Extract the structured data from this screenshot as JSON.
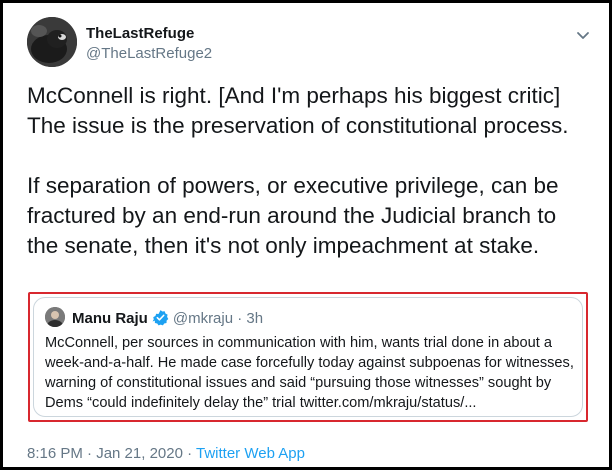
{
  "author": {
    "display_name": "TheLastRefuge",
    "handle": "@TheLastRefuge2"
  },
  "tweet": {
    "paragraphs": [
      "McConnell is right. [And I'm perhaps his biggest critic]\nThe issue is the preservation of constitutional process.",
      "If separation of powers, or executive privilege, can be\nfractured by an end-run around the Judicial branch to\nthe senate, then it's not only impeachment at stake."
    ]
  },
  "quoted_tweet": {
    "display_name": "Manu Raju",
    "handle": "@mkraju",
    "separator": "·",
    "time": "3h",
    "lines": [
      "McConnell, per sources in communication with him, wants trial done in about a",
      "week-and-a-half. He made case forcefully today against subpoenas for witnesses,",
      "warning of constitutional issues and said “pursuing those witnesses” sought by",
      "Dems “could indefinitely delay the” trial twitter.com/mkraju/status/..."
    ]
  },
  "footer": {
    "timestamp": "8:16 PM · Jan 21, 2020 · ",
    "source": "Twitter Web App"
  },
  "colors": {
    "text": "#14171a",
    "secondary": "#657786",
    "link": "#1da1f2",
    "highlight_border": "#d8282f",
    "verified": "#1da1f2"
  },
  "icons": {
    "menu": "chevron-down-icon",
    "verified": "verified-badge-icon"
  }
}
